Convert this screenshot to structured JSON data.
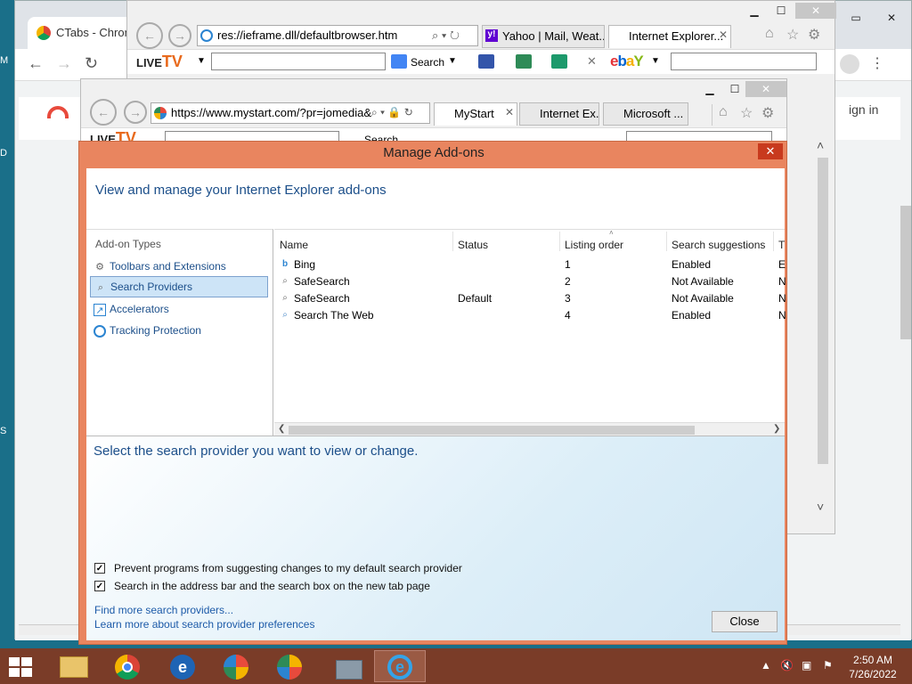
{
  "chrome": {
    "tab_title": "CTabs - Chrom",
    "sign_in": "ign in"
  },
  "ie_back": {
    "address": "res://ieframe.dll/defaultbrowser.htm",
    "tabs": [
      "Yahoo | Mail, Weat...",
      "Internet Explorer..."
    ],
    "toolbar": {
      "brand_live": "LIVE",
      "brand_tv": "TV",
      "search_label": "Search"
    }
  },
  "ie_front": {
    "address": "https://www.mystart.com/?pr=jomedia&",
    "tabs": [
      "MyStart",
      "Internet Ex...",
      "Microsoft ..."
    ],
    "toolbar": {
      "brand_live": "LIVE",
      "brand_tv": "TV",
      "search_label": "Search"
    }
  },
  "dialog": {
    "title": "Manage Add-ons",
    "heading": "View and manage your Internet Explorer add-ons",
    "addon_types_title": "Add-on Types",
    "addon_types": [
      {
        "label": "Toolbars and Extensions",
        "icon": "gear-icon"
      },
      {
        "label": "Search Providers",
        "icon": "search-icon"
      },
      {
        "label": "Accelerators",
        "icon": "accelerator-icon"
      },
      {
        "label": "Tracking Protection",
        "icon": "block-icon"
      }
    ],
    "selected_type": "Search Providers",
    "columns": [
      "Name",
      "Status",
      "Listing order",
      "Search suggestions",
      "T"
    ],
    "rows": [
      {
        "name": "Bing",
        "status": "",
        "order": "1",
        "suggestions": "Enabled",
        "t": "E",
        "icon": "bing-icon"
      },
      {
        "name": "SafeSearch",
        "status": "",
        "order": "2",
        "suggestions": "Not Available",
        "t": "N",
        "icon": "search-icon"
      },
      {
        "name": "SafeSearch",
        "status": "Default",
        "order": "3",
        "suggestions": "Not Available",
        "t": "N",
        "icon": "search-icon"
      },
      {
        "name": "Search The Web",
        "status": "",
        "order": "4",
        "suggestions": "Enabled",
        "t": "N",
        "icon": "search-web-icon"
      }
    ],
    "select_message": "Select the search provider you want to view or change.",
    "checkboxes": [
      {
        "label": "Prevent programs from suggesting changes to my default search provider",
        "checked": true
      },
      {
        "label": "Search in the address bar and the search box on the new tab page",
        "checked": true
      }
    ],
    "links": [
      "Find more search providers...",
      "Learn more about search provider preferences"
    ],
    "close_label": "Close"
  },
  "taskbar": {
    "time": "2:50 AM",
    "date": "7/26/2022",
    "apps": [
      "file-explorer-icon",
      "chrome-icon",
      "ie-old-icon",
      "app-icon",
      "app-icon",
      "briefcase-icon",
      "ie-icon"
    ],
    "active_app_index": 6
  },
  "colors": {
    "dialog_frame": "#e9855f",
    "link_blue": "#1c5aa8",
    "heading_blue": "#1c4f8a",
    "taskbar": "#7a3c28"
  }
}
